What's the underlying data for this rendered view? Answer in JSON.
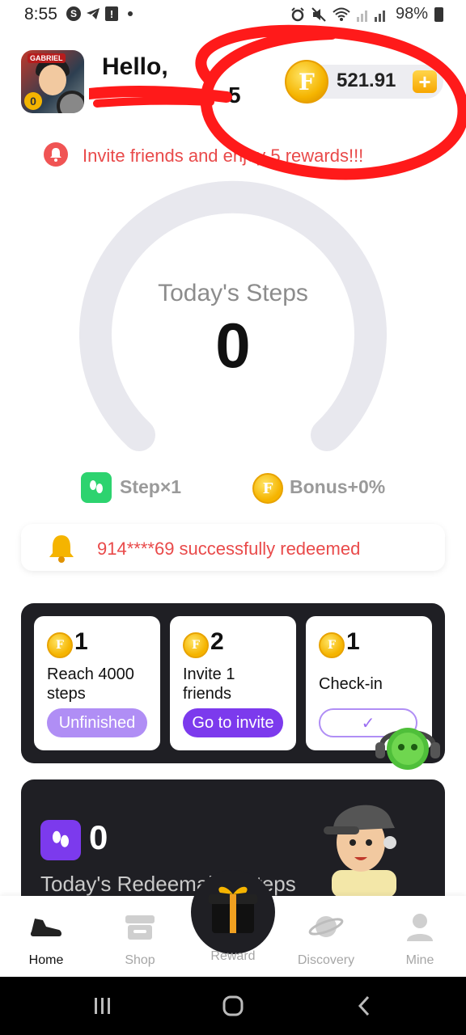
{
  "status_bar": {
    "time": "8:55",
    "battery": "98%"
  },
  "header": {
    "greeting": "Hello,",
    "user_id": "5",
    "avatar_tag": "GABRIEL",
    "avatar_level": "0",
    "coins": "521.91",
    "coin_symbol": "F",
    "plus": "+"
  },
  "notice": {
    "text": "Invite friends and enjoy 5 rewards!!!"
  },
  "gauge": {
    "label": "Today's Steps",
    "value": "0",
    "progress": 0
  },
  "multipliers": {
    "step": "Step×1",
    "bonus": "Bonus+0%"
  },
  "redeem_banner": {
    "text": "914****69 successfully redeemed"
  },
  "tasks": [
    {
      "reward": "1",
      "desc_line1": "Reach 4000",
      "desc_line2": "steps",
      "button": "Unfinished"
    },
    {
      "reward": "2",
      "desc_line1": "Invite 1",
      "desc_line2": "friends",
      "button": "Go to invite"
    },
    {
      "reward": "1",
      "desc_line1": "Check-in",
      "desc_line2": "",
      "button": "✓"
    }
  ],
  "redeemable": {
    "value": "0",
    "label": "Today's Redeemable Steps"
  },
  "tabs": [
    {
      "label": "Home",
      "icon": "shoe-icon",
      "active": true
    },
    {
      "label": "Shop",
      "icon": "shop-icon",
      "active": false
    },
    {
      "label": "Reward",
      "icon": "gift-icon",
      "active": false
    },
    {
      "label": "Discovery",
      "icon": "planet-icon",
      "active": false
    },
    {
      "label": "Mine",
      "icon": "person-icon",
      "active": false
    }
  ],
  "colors": {
    "accent_purple": "#7c3aed",
    "alert_red": "#e94a4a",
    "coin_gold": "#f5b400",
    "dark_panel": "#1f1f24"
  }
}
